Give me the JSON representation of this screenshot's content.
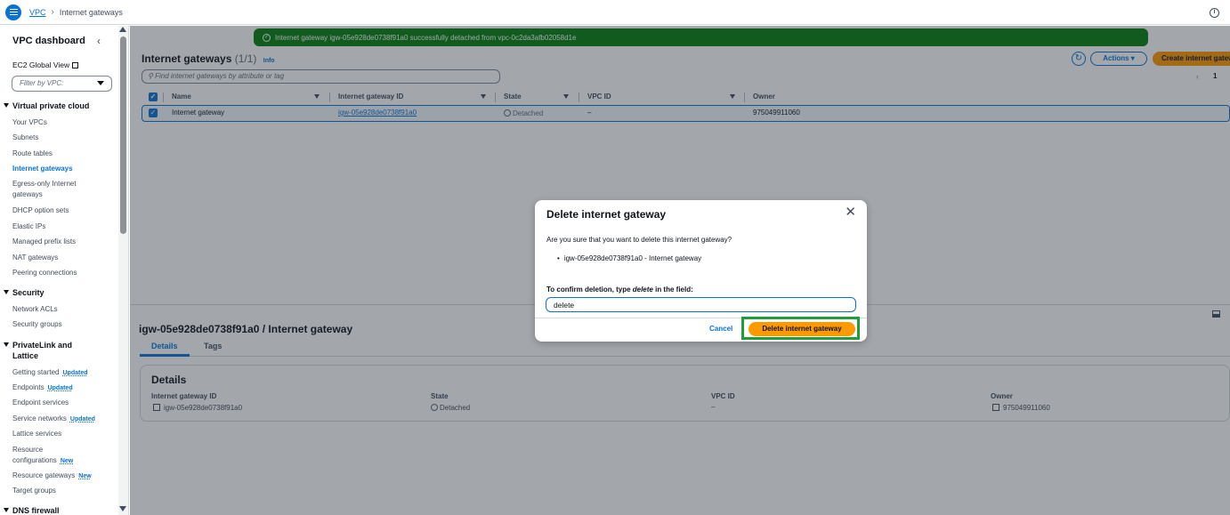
{
  "breadcrumb": {
    "service": "VPC",
    "current": "Internet gateways"
  },
  "sidebar": {
    "title": "VPC dashboard",
    "ec2_link": "EC2 Global View",
    "filter_placeholder": "Filter by VPC:",
    "sections": [
      {
        "label": "Virtual private cloud",
        "items": [
          "Your VPCs",
          "Subnets",
          "Route tables",
          "Internet gateways",
          "Egress-only Internet",
          "gateways",
          "DHCP option sets",
          "Elastic IPs",
          "Managed prefix lists",
          "NAT gateways",
          "Peering connections"
        ]
      },
      {
        "label": "Security",
        "items": [
          "Network ACLs",
          "Security groups"
        ]
      },
      {
        "label": "PrivateLink and",
        "label2": "Lattice",
        "items": [
          "Getting started",
          "Endpoints",
          "Endpoint services",
          "Service networks",
          "Lattice services",
          "Resource",
          "configurations",
          "Resource gateways",
          "Target groups"
        ]
      },
      {
        "label": "DNS firewall"
      }
    ],
    "badges": {
      "updated": "Updated",
      "new": "New"
    },
    "active_item": "Internet gateways"
  },
  "flash": {
    "message": "Internet gateway igw-05e928de0738f91a0 successfully detached from vpc-0c2da3afb02058d1e",
    "color": "#037f0c"
  },
  "list": {
    "title": "Internet gateways",
    "count": "(1/1)",
    "info": "Info",
    "actions_label": "Actions",
    "create_label": "Create internet gateway",
    "search_placeholder": "Find internet gateways by attribute or tag",
    "page": "1",
    "columns": [
      "Name",
      "Internet gateway ID",
      "State",
      "VPC ID",
      "Owner"
    ],
    "rows": [
      {
        "name": "Internet gateway",
        "id": "igw-05e928de0738f91a0",
        "state": "Detached",
        "vpc": "–",
        "owner": "975049911060"
      }
    ]
  },
  "details": {
    "heading": "igw-05e928de0738f91a0 / Internet gateway",
    "tabs": [
      "Details",
      "Tags"
    ],
    "card_title": "Details",
    "fields": [
      {
        "label": "Internet gateway ID",
        "value": "igw-05e928de0738f91a0"
      },
      {
        "label": "State",
        "value": "Detached"
      },
      {
        "label": "VPC ID",
        "value": "–"
      },
      {
        "label": "Owner",
        "value": "975049911060"
      }
    ]
  },
  "modal": {
    "title": "Delete internet gateway",
    "question": "Are you sure that you want to delete this internet gateway?",
    "item": "igw-05e928de0738f91a0 - Internet gateway",
    "confirm_prefix": "To confirm deletion, type ",
    "confirm_word": "delete",
    "confirm_suffix": " in the field:",
    "input_value": "delete",
    "cancel_label": "Cancel",
    "delete_label": "Delete internet gateway"
  },
  "colors": {
    "accent": "#0972d3",
    "primary_button": "#ff9900",
    "highlight": "#1e9e3a"
  }
}
